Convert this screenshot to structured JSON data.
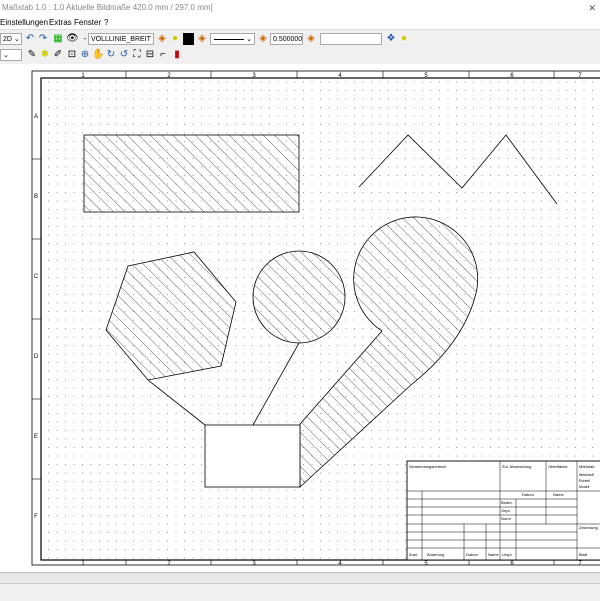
{
  "titlebar": {
    "text": "Maßstab 1.0 : 1.0   Aktuelle Bildmaße 420.0 mm / 297.0 mm]"
  },
  "menu": {
    "items": [
      "Einstellungen",
      "Extras",
      "Fenster",
      "?"
    ]
  },
  "toolbar": {
    "view_mode": "2D",
    "line_type": "VOLLLINIE_BREIT",
    "line_width": "0.500000",
    "extra_input": ""
  },
  "drawing": {
    "col_labels": [
      "1",
      "2",
      "3",
      "4",
      "5",
      "6",
      "7"
    ],
    "row_labels": [
      "A",
      "B",
      "C",
      "D",
      "E",
      "F"
    ],
    "title_block": {
      "r1": [
        "Verwendungsbereich",
        "Zul. Abweichung",
        "Oberfläche",
        "Maßstab"
      ],
      "r2": [
        "Werkstoff",
        "Rohteil",
        "Modell"
      ],
      "r3": [
        "Datum",
        "Name"
      ],
      "r4": [
        "Bearb.",
        "Gepr.",
        "Norm"
      ],
      "r5": [
        "Zust.",
        "Änderung",
        "Datum",
        "Name",
        "Urspr."
      ],
      "blatt": "Blatt",
      "blatt_label": "Zeichnung"
    }
  }
}
